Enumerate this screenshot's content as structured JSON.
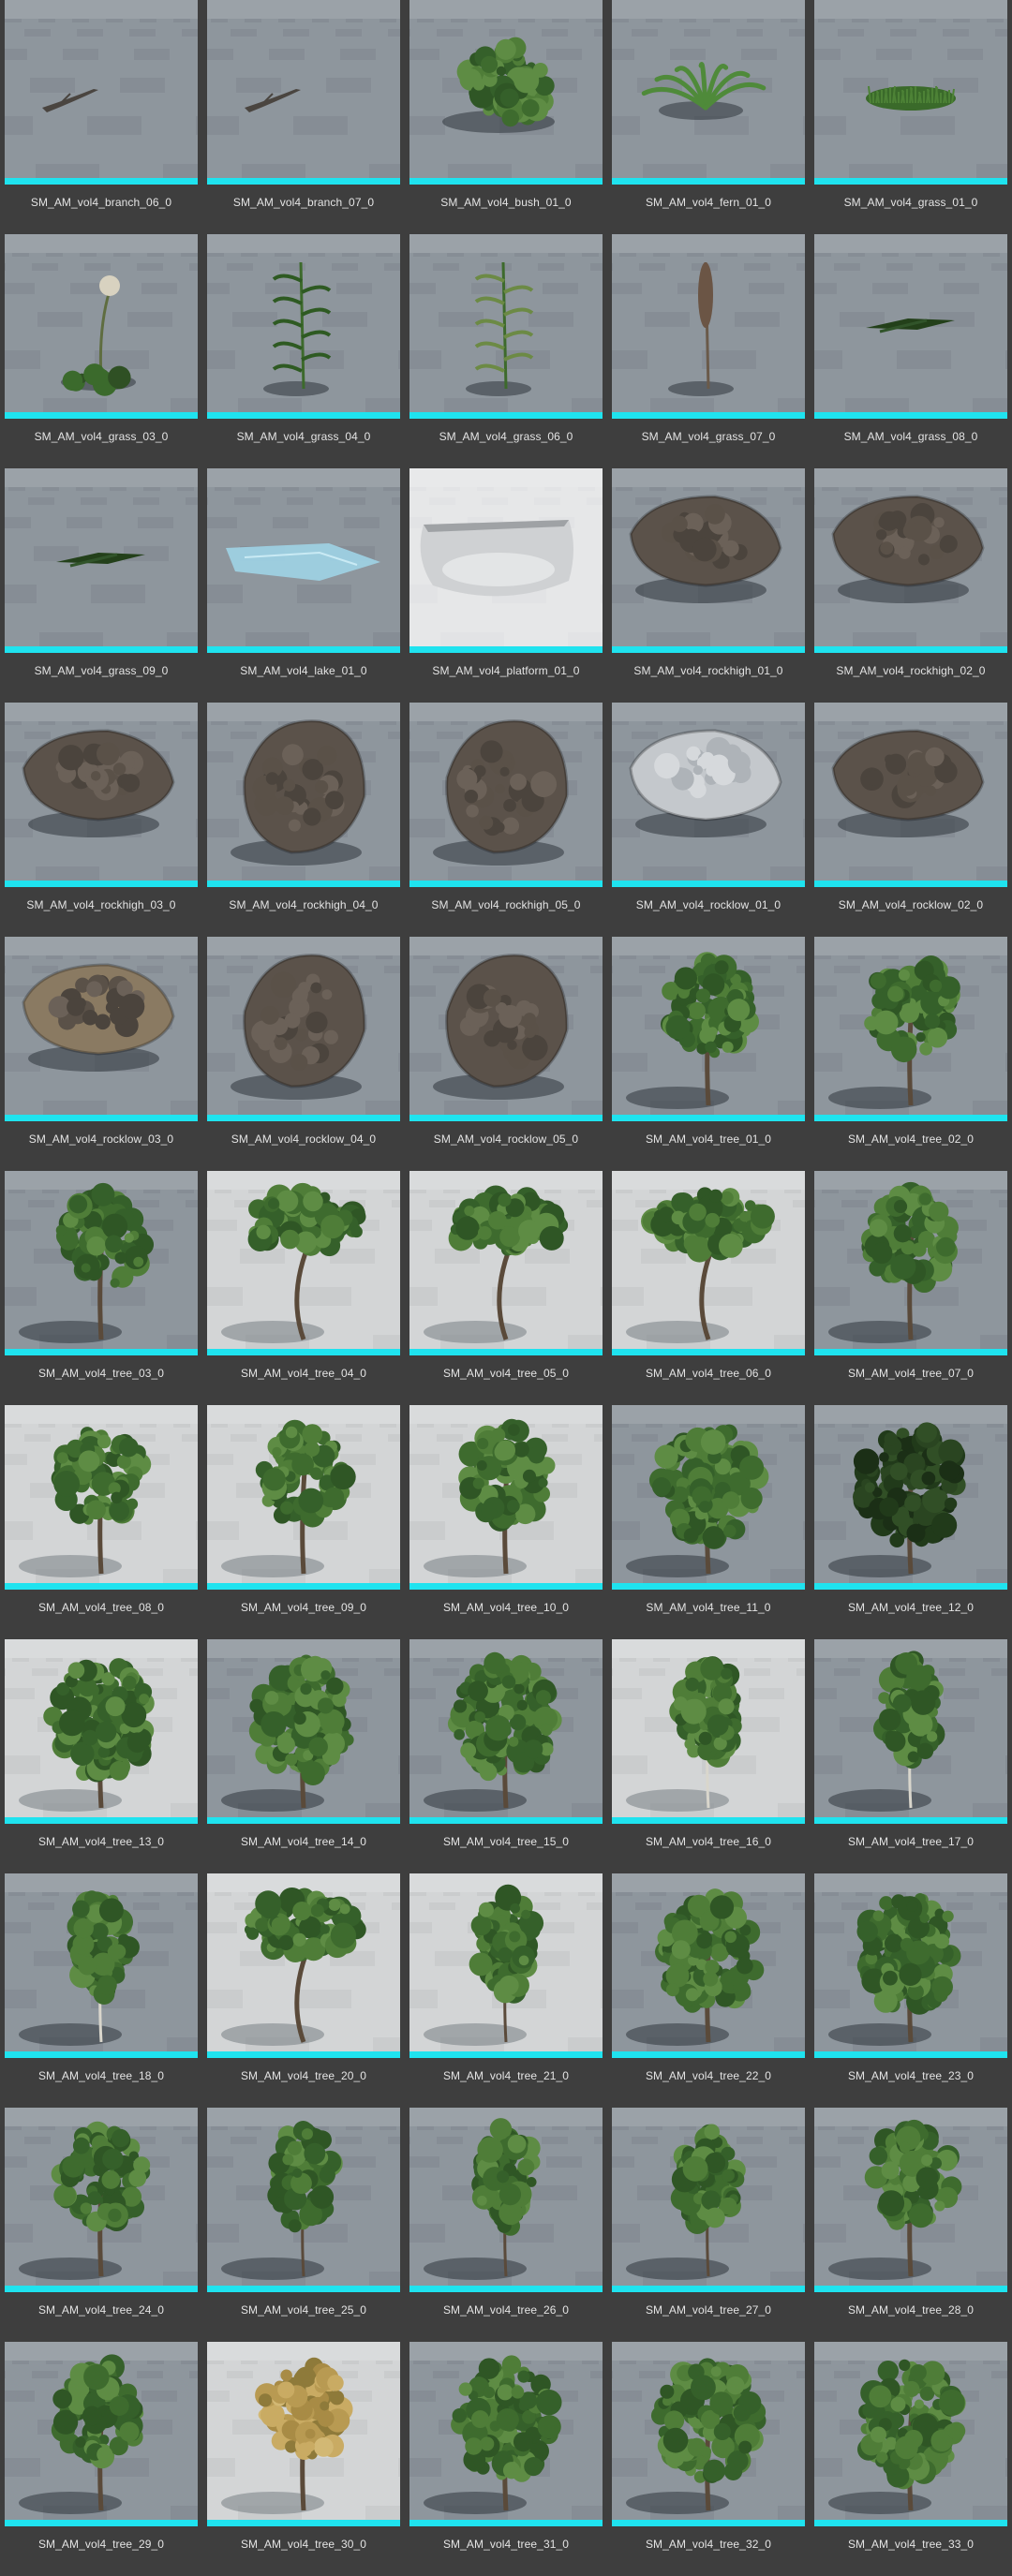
{
  "browser": {
    "selection_color": "#1fe3ef",
    "background": "#3e3e3e",
    "assets": [
      {
        "name": "SM_AM_vol4_branch_06_0",
        "kind": "branch",
        "floor": "dark"
      },
      {
        "name": "SM_AM_vol4_branch_07_0",
        "kind": "branch",
        "floor": "dark"
      },
      {
        "name": "SM_AM_vol4_bush_01_0",
        "kind": "bush",
        "floor": "dark"
      },
      {
        "name": "SM_AM_vol4_fern_01_0",
        "kind": "fern",
        "floor": "dark"
      },
      {
        "name": "SM_AM_vol4_grass_01_0",
        "kind": "grasspatch",
        "floor": "dark"
      },
      {
        "name": "SM_AM_vol4_grass_03_0",
        "kind": "dandelion",
        "floor": "dark"
      },
      {
        "name": "SM_AM_vol4_grass_04_0",
        "kind": "tallgrass",
        "floor": "dark"
      },
      {
        "name": "SM_AM_vol4_grass_06_0",
        "kind": "weed",
        "floor": "dark"
      },
      {
        "name": "SM_AM_vol4_grass_07_0",
        "kind": "seedhead",
        "floor": "dark"
      },
      {
        "name": "SM_AM_vol4_grass_08_0",
        "kind": "flatleaf",
        "floor": "dark"
      },
      {
        "name": "SM_AM_vol4_grass_09_0",
        "kind": "flatleaf",
        "floor": "dark"
      },
      {
        "name": "SM_AM_vol4_lake_01_0",
        "kind": "lake",
        "floor": "dark"
      },
      {
        "name": "SM_AM_vol4_platform_01_0",
        "kind": "platform",
        "floor": "white"
      },
      {
        "name": "SM_AM_vol4_rockhigh_01_0",
        "kind": "rock",
        "floor": "dark"
      },
      {
        "name": "SM_AM_vol4_rockhigh_02_0",
        "kind": "rock",
        "floor": "dark"
      },
      {
        "name": "SM_AM_vol4_rockhigh_03_0",
        "kind": "rock",
        "floor": "dark"
      },
      {
        "name": "SM_AM_vol4_rockhigh_04_0",
        "kind": "rocktall",
        "floor": "dark"
      },
      {
        "name": "SM_AM_vol4_rockhigh_05_0",
        "kind": "rocktall",
        "floor": "dark"
      },
      {
        "name": "SM_AM_vol4_rocklow_01_0",
        "kind": "rockgrey",
        "floor": "dark"
      },
      {
        "name": "SM_AM_vol4_rocklow_02_0",
        "kind": "rock",
        "floor": "dark"
      },
      {
        "name": "SM_AM_vol4_rocklow_03_0",
        "kind": "rockbrown",
        "floor": "dark"
      },
      {
        "name": "SM_AM_vol4_rocklow_04_0",
        "kind": "rocktall",
        "floor": "dark"
      },
      {
        "name": "SM_AM_vol4_rocklow_05_0",
        "kind": "rocktall",
        "floor": "dark"
      },
      {
        "name": "SM_AM_vol4_tree_01_0",
        "kind": "tree",
        "floor": "dark"
      },
      {
        "name": "SM_AM_vol4_tree_02_0",
        "kind": "tree",
        "floor": "dark"
      },
      {
        "name": "SM_AM_vol4_tree_03_0",
        "kind": "tree",
        "floor": "dark"
      },
      {
        "name": "SM_AM_vol4_tree_04_0",
        "kind": "treewide",
        "floor": "light"
      },
      {
        "name": "SM_AM_vol4_tree_05_0",
        "kind": "treewide",
        "floor": "light"
      },
      {
        "name": "SM_AM_vol4_tree_06_0",
        "kind": "treewide",
        "floor": "light"
      },
      {
        "name": "SM_AM_vol4_tree_07_0",
        "kind": "tree",
        "floor": "dark"
      },
      {
        "name": "SM_AM_vol4_tree_08_0",
        "kind": "tree",
        "floor": "light"
      },
      {
        "name": "SM_AM_vol4_tree_09_0",
        "kind": "tree",
        "floor": "light"
      },
      {
        "name": "SM_AM_vol4_tree_10_0",
        "kind": "treetall",
        "floor": "light"
      },
      {
        "name": "SM_AM_vol4_tree_11_0",
        "kind": "treefull",
        "floor": "dark"
      },
      {
        "name": "SM_AM_vol4_tree_12_0",
        "kind": "treedark",
        "floor": "dark"
      },
      {
        "name": "SM_AM_vol4_tree_13_0",
        "kind": "treefull",
        "floor": "light"
      },
      {
        "name": "SM_AM_vol4_tree_14_0",
        "kind": "treefull",
        "floor": "dark"
      },
      {
        "name": "SM_AM_vol4_tree_15_0",
        "kind": "treefull",
        "floor": "dark"
      },
      {
        "name": "SM_AM_vol4_tree_16_0",
        "kind": "birch",
        "floor": "light"
      },
      {
        "name": "SM_AM_vol4_tree_17_0",
        "kind": "birch",
        "floor": "dark"
      },
      {
        "name": "SM_AM_vol4_tree_18_0",
        "kind": "birch",
        "floor": "dark"
      },
      {
        "name": "SM_AM_vol4_tree_20_0",
        "kind": "treewide",
        "floor": "light"
      },
      {
        "name": "SM_AM_vol4_tree_21_0",
        "kind": "treethin",
        "floor": "light"
      },
      {
        "name": "SM_AM_vol4_tree_22_0",
        "kind": "treefull",
        "floor": "dark"
      },
      {
        "name": "SM_AM_vol4_tree_23_0",
        "kind": "treefull",
        "floor": "dark"
      },
      {
        "name": "SM_AM_vol4_tree_24_0",
        "kind": "tree",
        "floor": "dark"
      },
      {
        "name": "SM_AM_vol4_tree_25_0",
        "kind": "treethin",
        "floor": "dark"
      },
      {
        "name": "SM_AM_vol4_tree_26_0",
        "kind": "treethin",
        "floor": "dark"
      },
      {
        "name": "SM_AM_vol4_tree_27_0",
        "kind": "treethin",
        "floor": "dark"
      },
      {
        "name": "SM_AM_vol4_tree_28_0",
        "kind": "tree",
        "floor": "dark"
      },
      {
        "name": "SM_AM_vol4_tree_29_0",
        "kind": "tree",
        "floor": "dark"
      },
      {
        "name": "SM_AM_vol4_tree_30_0",
        "kind": "treeautumn",
        "floor": "light"
      },
      {
        "name": "SM_AM_vol4_tree_31_0",
        "kind": "treefull",
        "floor": "dark"
      },
      {
        "name": "SM_AM_vol4_tree_32_0",
        "kind": "treefull",
        "floor": "dark"
      },
      {
        "name": "SM_AM_vol4_tree_33_0",
        "kind": "treefull",
        "floor": "dark"
      }
    ]
  }
}
